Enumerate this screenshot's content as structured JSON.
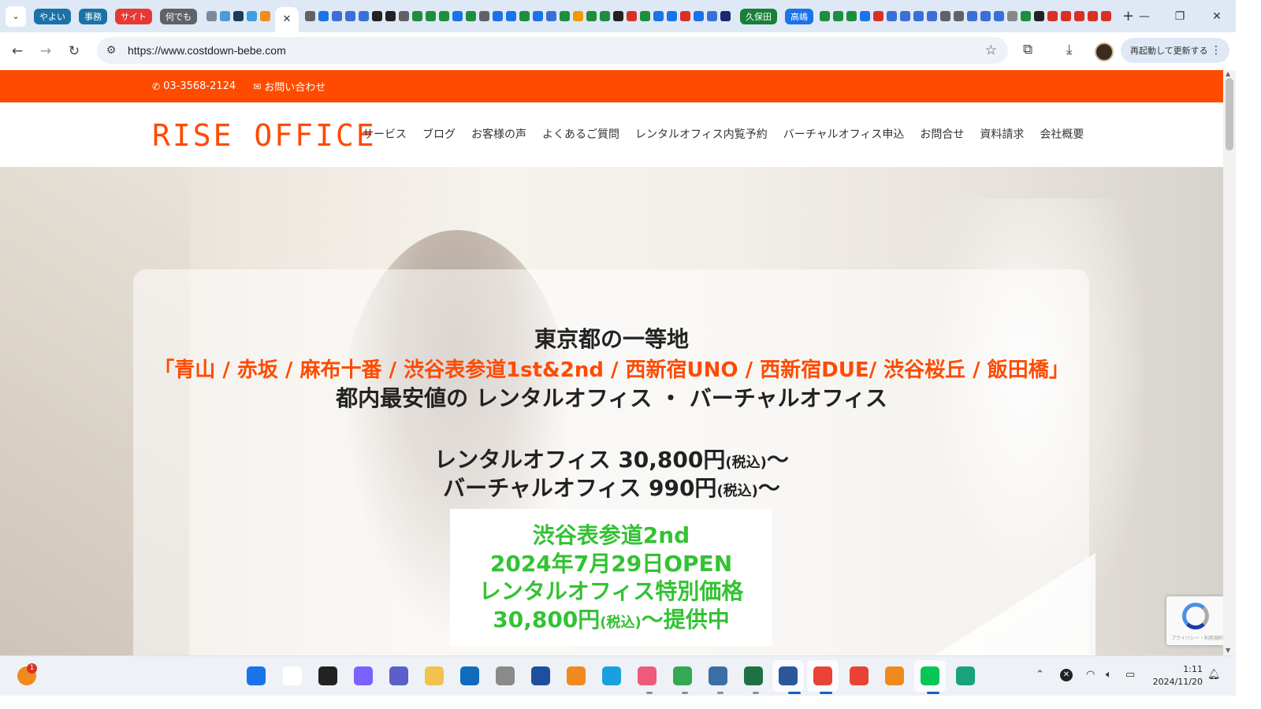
{
  "browser": {
    "tab_groups": [
      {
        "label": "やよい",
        "color": "#1a73a8"
      },
      {
        "label": "事務",
        "color": "#1a73a8"
      },
      {
        "label": "サイト",
        "color": "#e53935"
      },
      {
        "label": "何でも",
        "color": "#5f6368"
      }
    ],
    "tab_groups_right": [
      {
        "label": "久保田",
        "color": "#188038"
      },
      {
        "label": "高嶋",
        "color": "#1a73e8"
      }
    ],
    "active_tab_close": "✕",
    "new_tab": "+",
    "url": "https://www.costdown-bebe.com",
    "update_button": "再起動して更新する"
  },
  "site": {
    "phone": "03-3568-2124",
    "contact": "お問い合わせ",
    "logo_text": "RISE OFFICE",
    "nav": [
      "サービス",
      "ブログ",
      "お客様の声",
      "よくあるご質問",
      "レンタルオフィス内覧予約",
      "バーチャルオフィス申込",
      "お問合せ",
      "資料請求",
      "会社概要"
    ],
    "hero": {
      "line1": "東京都の一等地",
      "line2": "「青山 / 赤坂 / 麻布十番 / 渋谷表参道1st&2nd / 西新宿UNO / 西新宿DUE/ 渋谷桜丘 / 飯田橋」",
      "line3": "都内最安値の レンタルオフィス ・ バーチャルオフィス",
      "price_rental_label": "レンタルオフィス 30,800円",
      "price_rental_tax": "(税込)",
      "price_rental_suffix": "〜",
      "price_virtual_label": "バーチャルオフィス 990円",
      "price_virtual_tax": "(税込)",
      "price_virtual_suffix": "〜"
    },
    "promo": {
      "line1": "渋谷表参道2nd",
      "line2": "2024年7月29日OPEN",
      "line3": "レンタルオフィス特別価格",
      "line4_price": "30,800円",
      "line4_tax": "(税込)",
      "line4_suffix": "〜提供中"
    },
    "recaptcha_caption": "プライバシー・利用規約"
  },
  "taskbar": {
    "notification_badge": "1",
    "time": "1:11",
    "date": "2024/11/20"
  },
  "colors": {
    "brand": "#fe4b00",
    "promo_green": "#33c233"
  }
}
